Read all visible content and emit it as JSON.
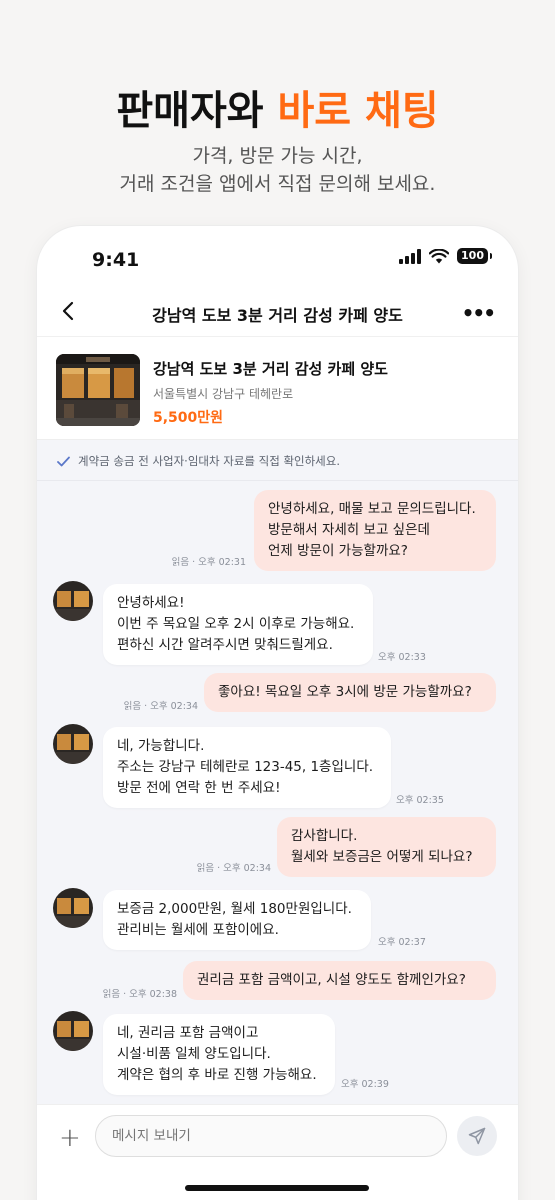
{
  "promo": {
    "title_main": "판매자와",
    "title_accent": "바로 채팅",
    "subtitle_line1": "가격, 방문 가능 시간,",
    "subtitle_line2": "거래 조건을 앱에서 직접 문의해 보세요."
  },
  "status_bar": {
    "time": "9:41",
    "battery": "100"
  },
  "header": {
    "title": "강남역 도보 3분 거리 감성 카페 양도",
    "more_label": "•••"
  },
  "listing": {
    "title": "강남역 도보 3분 거리 감성 카페 양도",
    "address": "서울특별시 강남구 테헤란로",
    "price": "5,500만원"
  },
  "notice": "계약금 송금 전 사업자·임대차 자료를 직접 확인하세요.",
  "messages": [
    {
      "from": "me",
      "text": "안녕하세요, 매물 보고 문의드립니다.\n방문해서 자세히 보고 싶은데\n언제 방문이 가능할까요?",
      "meta": "읽음 · 오후 02:31"
    },
    {
      "from": "seller",
      "text": "안녕하세요!\n이번 주 목요일 오후 2시 이후로 가능해요.\n편하신 시간 알려주시면 맞춰드릴게요.",
      "meta": "오후 02:33"
    },
    {
      "from": "me",
      "text": "좋아요! 목요일 오후 3시에 방문 가능할까요?",
      "meta": "읽음 · 오후 02:34"
    },
    {
      "from": "seller",
      "text": "네, 가능합니다.\n주소는 강남구 테헤란로 123-45, 1층입니다.\n방문 전에 연락 한 번 주세요!",
      "meta": "오후 02:35"
    },
    {
      "from": "me",
      "text": "감사합니다.\n월세와 보증금은 어떻게 되나요?",
      "meta": "읽음 · 오후 02:34"
    },
    {
      "from": "seller",
      "text": "보증금 2,000만원, 월세 180만원입니다.\n관리비는 월세에 포함이에요.",
      "meta": "오후 02:37"
    },
    {
      "from": "me",
      "text": "권리금 포함 금액이고, 시설 양도도 함께인가요?",
      "meta": "읽음 · 오후 02:38"
    },
    {
      "from": "seller",
      "text": "네, 권리금 포함 금액이고\n시설·비품 일체 양도입니다.\n계약은 협의 후 바로 진행 가능해요.",
      "meta": "오후 02:39"
    }
  ],
  "composer": {
    "placeholder": "메시지 보내기"
  },
  "icons": {
    "back": "chevron-left-icon",
    "more": "more-dots-icon",
    "check": "check-icon",
    "plus": "plus-icon",
    "send": "send-icon",
    "signal": "signal-icon",
    "wifi": "wifi-icon",
    "battery": "battery-icon"
  },
  "colors": {
    "accent": "#ff6a13",
    "my_bubble": "#fde5e0",
    "chat_bg": "#f4f5f9"
  }
}
